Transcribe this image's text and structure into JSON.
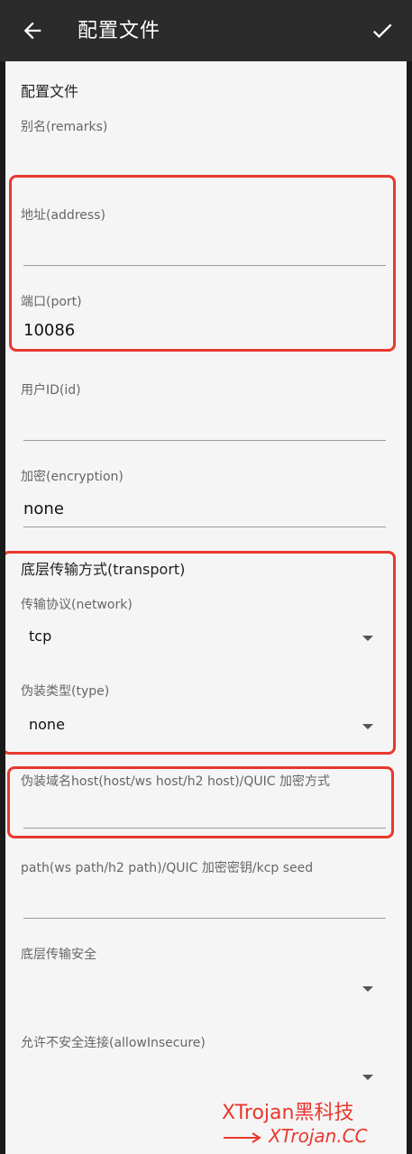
{
  "appbar": {
    "title": "配置文件",
    "back_icon": "arrow-left-icon",
    "save_icon": "check-icon"
  },
  "form": {
    "section_profile": "配置文件",
    "remarks_label": "别名(remarks)",
    "remarks_value": "",
    "address_label": "地址(address)",
    "address_value": "",
    "port_label": "端口(port)",
    "port_value": "10086",
    "id_label": "用户ID(id)",
    "id_value": "",
    "encryption_label": "加密(encryption)",
    "encryption_value": "none",
    "section_transport": "底层传输方式(transport)",
    "network_label": "传输协议(network)",
    "network_value": "tcp",
    "type_label": "伪装类型(type)",
    "type_value": "none",
    "host_label": "伪装域名host(host/ws host/h2 host)/QUIC 加密方式",
    "host_value": "",
    "path_label": "path(ws path/h2 path)/QUIC 加密密钥/kcp seed",
    "path_value": "",
    "security_label": "底层传输安全",
    "security_value": "",
    "insecure_label": "允许不安全连接(allowInsecure)",
    "insecure_value": ""
  },
  "watermark": {
    "line1": "XTrojan黑科技",
    "line2": "XTrojan.CC"
  },
  "colors": {
    "appbar": "#2b2b2b",
    "background": "#f5f5f5",
    "highlight": "#e8382e"
  }
}
